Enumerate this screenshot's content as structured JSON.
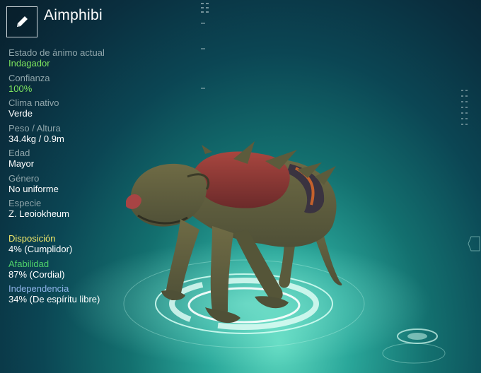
{
  "creature": {
    "name": "Aimphibi"
  },
  "stats": [
    {
      "label": "Estado de ánimo actual",
      "value": "Indagador",
      "value_color": "green"
    },
    {
      "label": "Confianza",
      "value": "100%",
      "value_color": "green"
    },
    {
      "label": "Clima nativo",
      "value": "Verde",
      "value_color": "white"
    },
    {
      "label": "Peso / Altura",
      "value": "34.4kg / 0.9m",
      "value_color": "white"
    },
    {
      "label": "Edad",
      "value": "Mayor",
      "value_color": "white"
    },
    {
      "label": "Género",
      "value": "No uniforme",
      "value_color": "white"
    },
    {
      "label": "Especie",
      "value": "Z. Leoiokheum",
      "value_color": "white"
    }
  ],
  "traits": [
    {
      "label": "Disposición",
      "value": "4% (Cumplidor)",
      "color": "#f2e86a"
    },
    {
      "label": "Afabilidad",
      "value": "87% (Cordial)",
      "color": "#4fd26a"
    },
    {
      "label": "Independencia",
      "value": "34% (De espíritu libre)",
      "color": "#8fb3e8"
    }
  ],
  "icons": {
    "edit": "pencil-icon"
  }
}
